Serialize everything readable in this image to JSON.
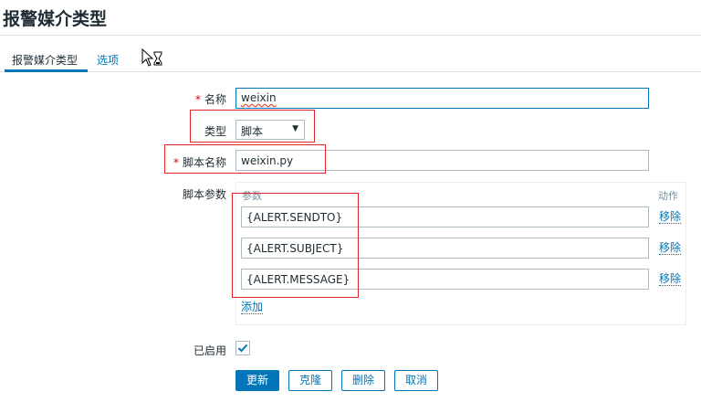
{
  "page": {
    "title": "报警媒介类型"
  },
  "tabs": [
    {
      "label": "报警媒介类型",
      "active": true
    },
    {
      "label": "选项",
      "active": false
    }
  ],
  "form": {
    "required_mark": "*",
    "name": {
      "label": "名称",
      "value": "weixin"
    },
    "type": {
      "label": "类型",
      "value": "脚本"
    },
    "script_name": {
      "label": "脚本名称",
      "value": "weixin.py"
    },
    "script_params": {
      "label": "脚本参数",
      "header_param": "参数",
      "header_action": "动作",
      "rows": [
        {
          "value": "{ALERT.SENDTO}",
          "remove": "移除"
        },
        {
          "value": "{ALERT.SUBJECT}",
          "remove": "移除"
        },
        {
          "value": "{ALERT.MESSAGE}",
          "remove": "移除"
        }
      ],
      "add_label": "添加"
    },
    "enabled": {
      "label": "已启用",
      "checked": true
    }
  },
  "buttons": {
    "update": "更新",
    "clone": "克隆",
    "delete": "删除",
    "cancel": "取消"
  },
  "colors": {
    "accent": "#0275b8",
    "annotation": "#e0262a",
    "required": "#d40000"
  }
}
